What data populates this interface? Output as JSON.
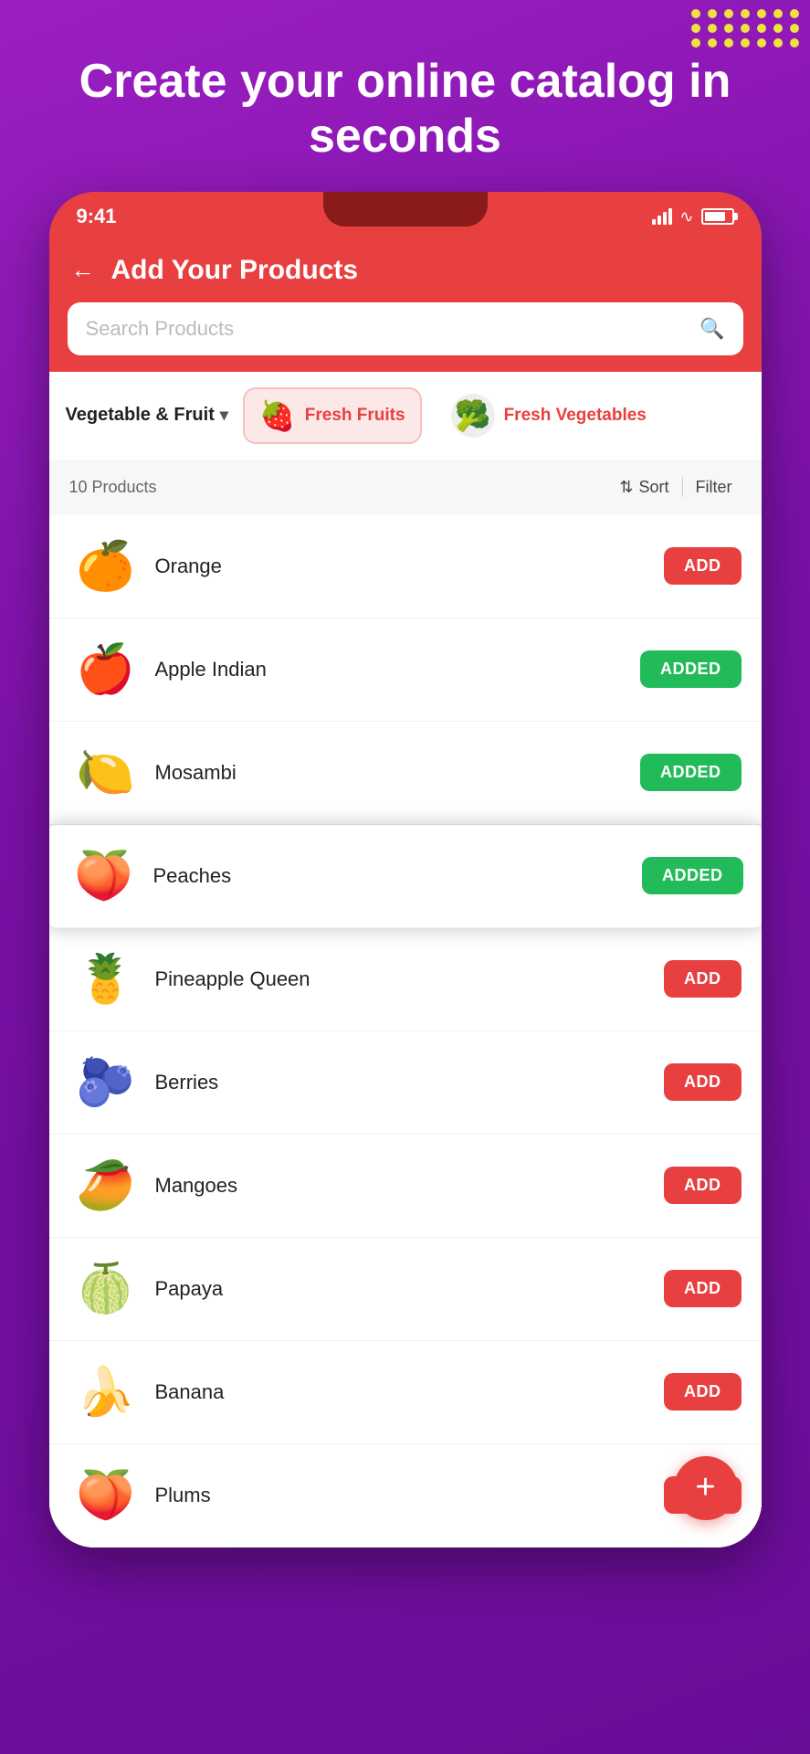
{
  "hero": {
    "title": "Create your online catalog in seconds"
  },
  "phone": {
    "status_time": "9:41",
    "header": {
      "title": "Add Your Products",
      "back_label": "←"
    },
    "search": {
      "placeholder": "Search Products"
    },
    "categories": {
      "dropdown_label": "Vegetable & Fruit",
      "items": [
        {
          "id": "fresh-fruits",
          "label": "Fresh Fruits",
          "emoji": "🍓🍋🍇",
          "active": true
        },
        {
          "id": "fresh-vegetables",
          "label": "Fresh Vegetables",
          "emoji": "🥦🥕🍅",
          "active": false
        }
      ]
    },
    "products": {
      "count_label": "10 Products",
      "sort_label": "Sort",
      "filter_label": "Filter",
      "items": [
        {
          "id": "orange",
          "name": "Orange",
          "emoji": "🍊",
          "status": "add"
        },
        {
          "id": "apple-indian",
          "name": "Apple Indian",
          "emoji": "🍎",
          "status": "added"
        },
        {
          "id": "mosambi",
          "name": "Mosambi",
          "emoji": "🍋",
          "status": "added"
        },
        {
          "id": "peaches",
          "name": "Peaches",
          "emoji": "🍑",
          "status": "added",
          "elevated": true
        },
        {
          "id": "pineapple-queen",
          "name": "Pineapple Queen",
          "emoji": "🍍",
          "status": "add"
        },
        {
          "id": "berries",
          "name": "Berries",
          "emoji": "🫐",
          "status": "add"
        },
        {
          "id": "mangoes",
          "name": "Mangoes",
          "emoji": "🥭",
          "status": "add"
        },
        {
          "id": "papaya",
          "name": "Papaya",
          "emoji": "🍈",
          "status": "add"
        },
        {
          "id": "banana",
          "name": "Banana",
          "emoji": "🍌",
          "status": "add"
        },
        {
          "id": "plums",
          "name": "Plums",
          "emoji": "🍑",
          "status": "add"
        }
      ],
      "add_label": "ADD",
      "added_label": "ADDED"
    }
  },
  "fab": {
    "label": "+"
  },
  "dots": [
    1,
    2,
    3,
    4,
    5,
    6,
    7,
    8,
    9,
    10,
    11,
    12,
    13,
    14,
    15,
    16,
    17,
    18,
    19,
    20,
    21
  ]
}
